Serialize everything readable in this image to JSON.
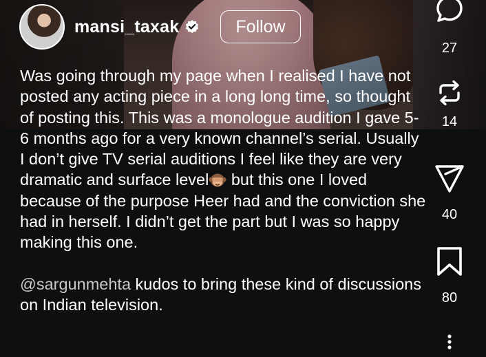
{
  "post": {
    "username": "mansi_taxak",
    "verified_icon": "verified-badge-icon",
    "follow_label": "Follow",
    "caption_paragraph_1": "Was going through my page when I realised I have not posted any acting piece in a long long time, so thought of posting this. This was a monologue audition I gave 5-6 months ago for a very known channel’s serial. Usually I don’t give TV serial auditions I feel like they are very dramatic and surface level",
    "caption_emoji": "🙈",
    "caption_paragraph_1_end": " but this one I loved because of the purpose Heer had and the conviction she had in herself. I didn’t get the part but I was so happy making this one.",
    "mention": "@sargunmehta",
    "caption_paragraph_2": " kudos to bring these kind of discussions on Indian television."
  },
  "actions": {
    "comments": {
      "icon": "comment-icon",
      "count": "27"
    },
    "reposts": {
      "icon": "repost-icon",
      "count": "14"
    },
    "shares": {
      "icon": "share-icon",
      "count": "40"
    },
    "saves": {
      "icon": "bookmark-icon",
      "count": "80"
    },
    "more": {
      "icon": "more-options-icon"
    }
  },
  "colors": {
    "background": "#0d0f10",
    "text": "#ffffff",
    "mention": "#c9c9c9"
  }
}
